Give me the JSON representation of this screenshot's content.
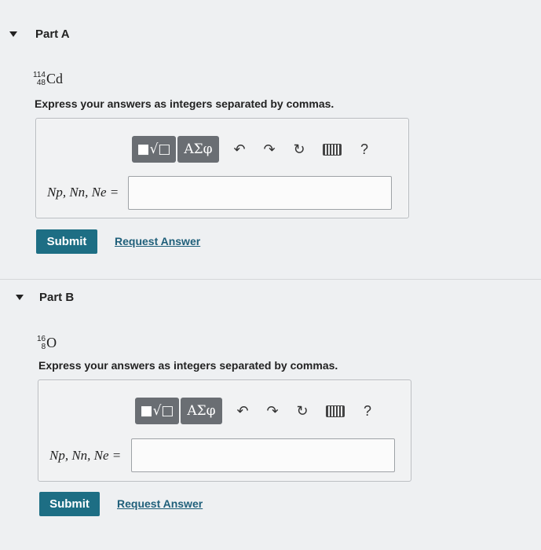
{
  "parts": [
    {
      "title": "Part A",
      "nuclide": {
        "mass_number": "114",
        "atomic_number": "48",
        "symbol": "Cd"
      },
      "instruction": "Express your answers as integers separated by commas.",
      "toolbar": {
        "templates_label": "■√□",
        "greek_label": "ΑΣφ",
        "help_label": "?"
      },
      "answer_label": "Np, Nn, Ne =",
      "answer_value": "",
      "submit_label": "Submit",
      "request_answer_label": "Request Answer"
    },
    {
      "title": "Part B",
      "nuclide": {
        "mass_number": "16",
        "atomic_number": "8",
        "symbol": "O"
      },
      "instruction": "Express your answers as integers separated by commas.",
      "toolbar": {
        "templates_label": "■√□",
        "greek_label": "ΑΣφ",
        "help_label": "?"
      },
      "answer_label": "Np, Nn, Ne =",
      "answer_value": "",
      "submit_label": "Submit",
      "request_answer_label": "Request Answer"
    }
  ],
  "icons": {
    "caret": "caret-down-icon",
    "undo": "undo-icon",
    "redo": "redo-icon",
    "reset": "reset-icon",
    "keyboard": "keyboard-icon"
  }
}
